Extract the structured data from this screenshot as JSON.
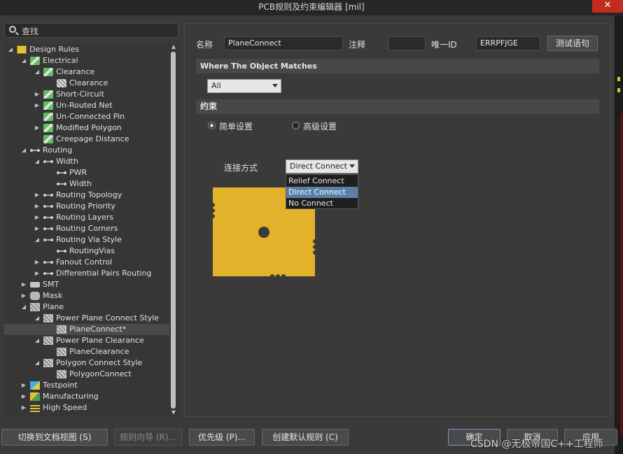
{
  "window": {
    "title": "PCB规则及约束编辑器 [mil]",
    "close_glyph": "✕"
  },
  "search": {
    "label": "查找"
  },
  "tree": [
    {
      "label": "Design Rules",
      "indent": 0,
      "arrow": "◢",
      "icon": "design"
    },
    {
      "label": "Electrical",
      "indent": 1,
      "arrow": "◢",
      "icon": "rule"
    },
    {
      "label": "Clearance",
      "indent": 2,
      "arrow": "◢",
      "icon": "rule"
    },
    {
      "label": "Clearance",
      "indent": 3,
      "arrow": "",
      "icon": "wave"
    },
    {
      "label": "Short-Circuit",
      "indent": 2,
      "arrow": "▶",
      "icon": "rule"
    },
    {
      "label": "Un-Routed Net",
      "indent": 2,
      "arrow": "▶",
      "icon": "rule"
    },
    {
      "label": "Un-Connected Pin",
      "indent": 2,
      "arrow": "",
      "icon": "rule"
    },
    {
      "label": "Modified Polygon",
      "indent": 2,
      "arrow": "▶",
      "icon": "rule"
    },
    {
      "label": "Creepage Distance",
      "indent": 2,
      "arrow": "",
      "icon": "rule"
    },
    {
      "label": "Routing",
      "indent": 1,
      "arrow": "◢",
      "icon": "route"
    },
    {
      "label": "Width",
      "indent": 2,
      "arrow": "◢",
      "icon": "route"
    },
    {
      "label": "PWR",
      "indent": 3,
      "arrow": "",
      "icon": "route"
    },
    {
      "label": "Width",
      "indent": 3,
      "arrow": "",
      "icon": "route"
    },
    {
      "label": "Routing Topology",
      "indent": 2,
      "arrow": "▶",
      "icon": "route"
    },
    {
      "label": "Routing Priority",
      "indent": 2,
      "arrow": "▶",
      "icon": "route"
    },
    {
      "label": "Routing Layers",
      "indent": 2,
      "arrow": "▶",
      "icon": "route"
    },
    {
      "label": "Routing Corners",
      "indent": 2,
      "arrow": "▶",
      "icon": "route"
    },
    {
      "label": "Routing Via Style",
      "indent": 2,
      "arrow": "◢",
      "icon": "route"
    },
    {
      "label": "RoutingVias",
      "indent": 3,
      "arrow": "",
      "icon": "route"
    },
    {
      "label": "Fanout Control",
      "indent": 2,
      "arrow": "▶",
      "icon": "route"
    },
    {
      "label": "Differential Pairs Routing",
      "indent": 2,
      "arrow": "▶",
      "icon": "route"
    },
    {
      "label": "SMT",
      "indent": 1,
      "arrow": "▶",
      "icon": "smt"
    },
    {
      "label": "Mask",
      "indent": 1,
      "arrow": "▶",
      "icon": "mask"
    },
    {
      "label": "Plane",
      "indent": 1,
      "arrow": "◢",
      "icon": "plane"
    },
    {
      "label": "Power Plane Connect Style",
      "indent": 2,
      "arrow": "◢",
      "icon": "plane"
    },
    {
      "label": "PlaneConnect*",
      "indent": 3,
      "arrow": "",
      "icon": "plane",
      "selected": true
    },
    {
      "label": "Power Plane Clearance",
      "indent": 2,
      "arrow": "◢",
      "icon": "plane"
    },
    {
      "label": "PlaneClearance",
      "indent": 3,
      "arrow": "",
      "icon": "plane"
    },
    {
      "label": "Polygon Connect Style",
      "indent": 2,
      "arrow": "◢",
      "icon": "plane"
    },
    {
      "label": "PolygonConnect",
      "indent": 3,
      "arrow": "",
      "icon": "plane"
    },
    {
      "label": "Testpoint",
      "indent": 1,
      "arrow": "▶",
      "icon": "test"
    },
    {
      "label": "Manufacturing",
      "indent": 1,
      "arrow": "▶",
      "icon": "manu"
    },
    {
      "label": "High Speed",
      "indent": 1,
      "arrow": "▶",
      "icon": "hs"
    }
  ],
  "rule": {
    "name_label": "名称",
    "name_value": "PlaneConnect",
    "comment_label": "注释",
    "comment_value": "",
    "uid_label": "唯一ID",
    "uid_value": "ERRPFJGE",
    "test_button": "测试语句"
  },
  "match": {
    "header": "Where The Object Matches",
    "scope_value": "All"
  },
  "constraints": {
    "header": "约束",
    "simple_label": "简单设置",
    "advanced_label": "高级设置",
    "connect_label": "连接方式",
    "connect_value": "Direct Connect",
    "options": [
      "Relief Connect",
      "Direct Connect",
      "No Connect"
    ],
    "highlighted_index": 1
  },
  "buttons": {
    "doc_view": "切换到文档视图 (S)",
    "wizard": "规则向导 (R)...",
    "priority": "优先级 (P)...",
    "default_rules": "创建默认规则 (C)",
    "ok": "确定",
    "cancel": "取消",
    "apply": "应用"
  },
  "watermark": "CSDN @无极帝国C++工程师",
  "colors": {
    "pad": "#e2b22a",
    "highlight": "#5a7fa8",
    "close": "#c42b1c"
  }
}
